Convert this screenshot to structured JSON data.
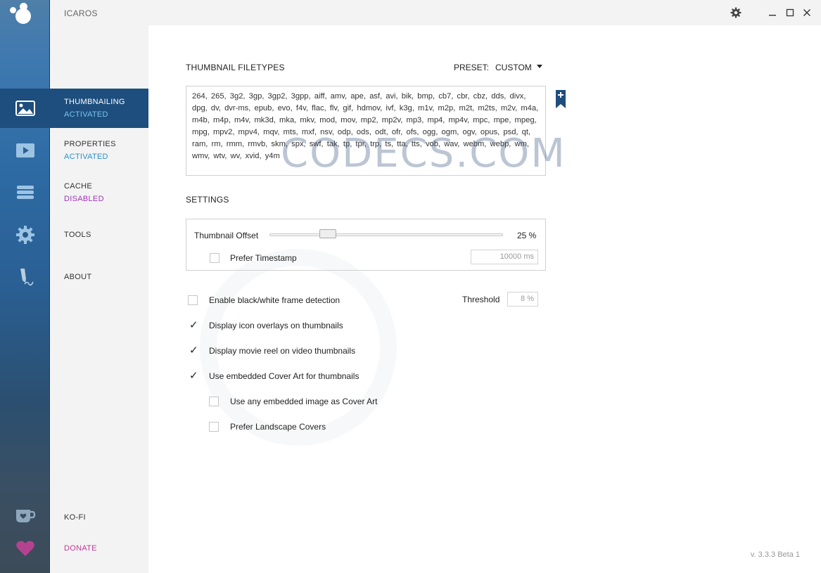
{
  "window": {
    "title": "ICAROS"
  },
  "nav": {
    "items": [
      {
        "label": "THUMBNAILING",
        "status": "ACTIVATED"
      },
      {
        "label": "PROPERTIES",
        "status": "ACTIVATED"
      },
      {
        "label": "CACHE",
        "status": "DISABLED"
      },
      {
        "label": "TOOLS",
        "status": ""
      },
      {
        "label": "ABOUT",
        "status": ""
      }
    ],
    "kofi": "KO-FI",
    "donate": "DONATE"
  },
  "thumbnail": {
    "section_title": "THUMBNAIL FILETYPES",
    "preset_label": "PRESET:",
    "preset_value": "CUSTOM",
    "filetypes": "264, 265, 3g2, 3gp, 3gp2, 3gpp, aiff, amv, ape, asf, avi, bik, bmp, cb7, cbr, cbz, dds, divx, dpg, dv, dvr-ms, epub, evo, f4v, flac, flv, gif, hdmov, ivf, k3g, m1v, m2p, m2t, m2ts, m2v, m4a, m4b, m4p, m4v, mk3d, mka, mkv, mod, mov, mp2, mp2v, mp3, mp4, mp4v, mpc, mpe, mpeg, mpg, mpv2, mpv4, mqv, mts, mxf, nsv, odp, ods, odt, ofr, ofs, ogg, ogm, ogv, opus, psd, qt, ram, rm, rmm, rmvb, skm, spx, swf, tak, tp, tpr, trp, ts, tta, tts, vob, wav, webm, webp, wm, wmv, wtv, wv, xvid, y4m"
  },
  "settings": {
    "section_title": "SETTINGS",
    "offset_label": "Thumbnail Offset",
    "offset_value_text": "25 %",
    "offset_fraction": 0.25,
    "prefer_timestamp_label": "Prefer Timestamp",
    "timestamp_value": "10000 ms",
    "bw_detection_label": "Enable black/white frame detection",
    "threshold_label": "Threshold",
    "threshold_value": "8 %",
    "options": [
      {
        "label": "Display icon overlays on thumbnails",
        "checked": true
      },
      {
        "label": "Display movie reel on video thumbnails",
        "checked": true
      },
      {
        "label": "Use embedded Cover Art for thumbnails",
        "checked": true
      },
      {
        "label": "Use any embedded image as Cover Art",
        "checked": false
      },
      {
        "label": "Prefer Landscape Covers",
        "checked": false
      }
    ]
  },
  "watermark": "CODECS.COM",
  "version": "v. 3.3.3 Beta 1",
  "colors": {
    "active_nav": "#1d4e7d",
    "activated": "#2a8fd0",
    "disabled": "#a035b6",
    "donate": "#c0399a"
  },
  "icons": [
    "app-logo-icon",
    "image-icon",
    "play-icon",
    "cache-stack-icon",
    "gear-icon",
    "pen-icon",
    "coffee-cup-icon",
    "heart-icon",
    "bookmark-add-icon"
  ]
}
